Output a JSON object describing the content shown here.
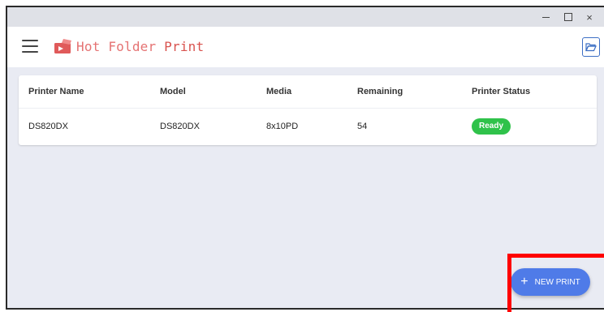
{
  "app": {
    "title": "Hot Folder Print",
    "logo_text_1": "Hot Folder",
    "logo_text_2": " Print"
  },
  "window_controls": {
    "minimize_icon": "minimize-icon",
    "maximize_icon": "maximize-icon",
    "close_symbol": "×"
  },
  "toolbar": {
    "menu_icon": "hamburger-menu-icon",
    "folder_icon": "folder-open-icon"
  },
  "table": {
    "columns": [
      "Printer Name",
      "Model",
      "Media",
      "Remaining",
      "Printer Status"
    ],
    "rows": [
      {
        "printer_name": "DS820DX",
        "model": "DS820DX",
        "media": "8x10PD",
        "remaining": "54",
        "status": "Ready"
      }
    ]
  },
  "fab": {
    "label": "NEW PRINT",
    "icon": "plus-icon"
  },
  "colors": {
    "accent": "#4f7be8",
    "status_ready": "#2fc24a",
    "logo": "#e57373",
    "highlight": "#ff0000"
  }
}
